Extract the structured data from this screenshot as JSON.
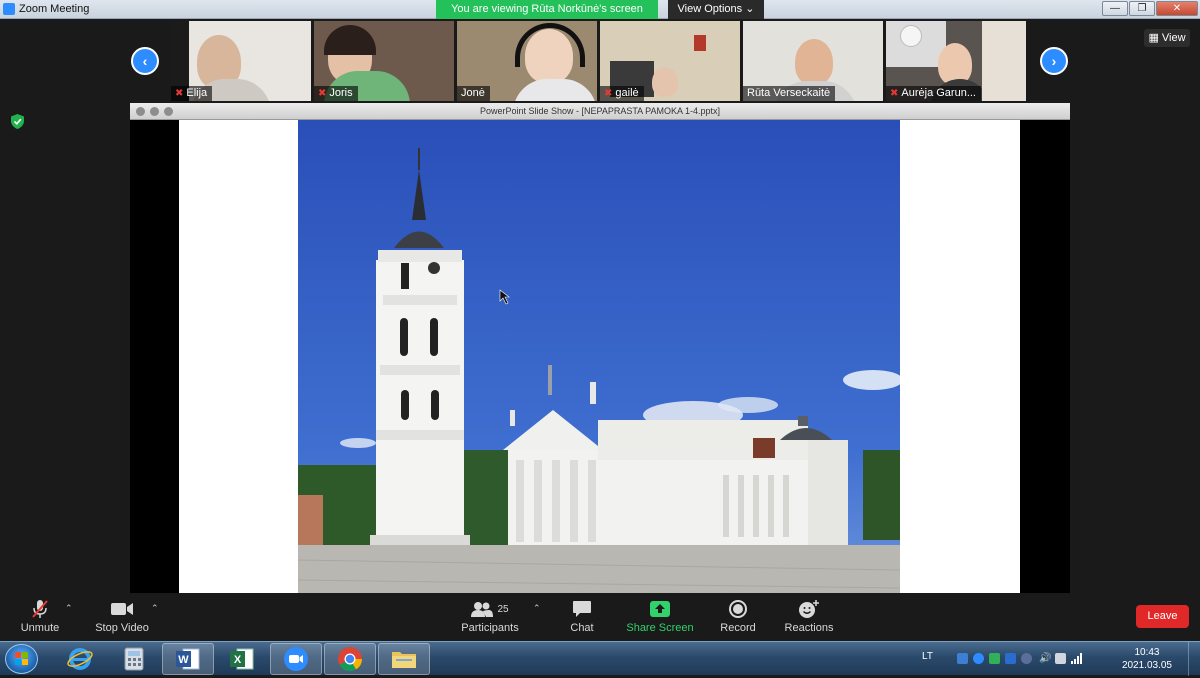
{
  "window": {
    "title": "Zoom Meeting",
    "viewing_banner": "You are viewing Rūta Norkūnė's screen",
    "view_options": "View Options ⌄",
    "view_button": "View"
  },
  "gallery": {
    "participants": [
      {
        "name": "Elija"
      },
      {
        "name": "Joris"
      },
      {
        "name": "Jonė"
      },
      {
        "name": "gailė"
      },
      {
        "name": "Rūta Verseckaitė"
      },
      {
        "name": "Aurėja Garun..."
      }
    ]
  },
  "slideshow": {
    "title": "PowerPoint Slide Show - [NEPAPRASTA PAMOKA 1-4.pptx]"
  },
  "toolbar": {
    "unmute": "Unmute",
    "stop_video": "Stop Video",
    "participants": "Participants",
    "participant_count": "25",
    "chat": "Chat",
    "share_screen": "Share Screen",
    "record": "Record",
    "reactions": "Reactions",
    "leave": "Leave"
  },
  "taskbar": {
    "language": "LT",
    "time": "10:43",
    "date": "2021.03.05"
  },
  "colors": {
    "zoom_blue": "#2d8cff",
    "banner_green": "#24c05a",
    "leave_red": "#e02828",
    "share_green": "#32d16b"
  }
}
